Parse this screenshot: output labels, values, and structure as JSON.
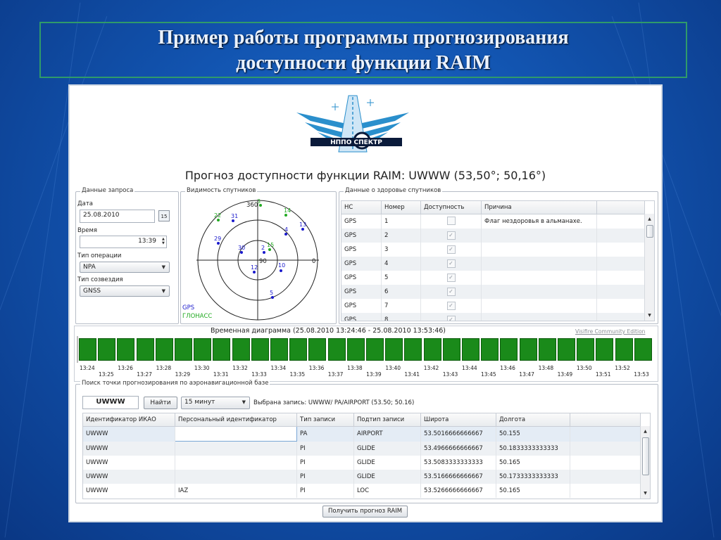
{
  "slide": {
    "title_line1": "Пример  работы программы прогнозирования",
    "title_line2": "доступности функции RAIM"
  },
  "logo": {
    "text": "НППО СПЕКТР"
  },
  "report_title": "Прогноз доступности функции RAIM: UWWW (53,50°; 50,16°)",
  "request": {
    "legend": "Данные запроса",
    "date_label": "Дата",
    "date_value": "25.08.2010",
    "calendar_num": "15",
    "time_label": "Время",
    "time_value": "13:39",
    "op_label": "Тип операции",
    "op_value": "NPA",
    "const_label": "Тип созвездия",
    "const_value": "GNSS"
  },
  "visibility": {
    "legend": "Видимость спутников",
    "labels": {
      "top": "360",
      "right": "0",
      "center": "90"
    },
    "legend_gps": "GPS",
    "legend_glonass": "ГЛОНАСС",
    "colors": {
      "gps": "#1a1acc",
      "glonass": "#22aa22"
    },
    "satellites": [
      {
        "id": "3",
        "sys": "glonass"
      },
      {
        "id": "14",
        "sys": "glonass"
      },
      {
        "id": "22",
        "sys": "glonass"
      },
      {
        "id": "31",
        "sys": "gps"
      },
      {
        "id": "13",
        "sys": "gps"
      },
      {
        "id": "4",
        "sys": "gps"
      },
      {
        "id": "29",
        "sys": "gps"
      },
      {
        "id": "30",
        "sys": "gps"
      },
      {
        "id": "2",
        "sys": "gps"
      },
      {
        "id": "15",
        "sys": "glonass"
      },
      {
        "id": "12",
        "sys": "gps"
      },
      {
        "id": "10",
        "sys": "gps"
      },
      {
        "id": "5",
        "sys": "gps"
      }
    ]
  },
  "health": {
    "legend": "Данные о здоровье спутников",
    "columns": [
      "НС",
      "Номер",
      "Доступность",
      "Причина"
    ],
    "rows": [
      {
        "ns": "GPS",
        "num": "1",
        "avail": "",
        "reason": "Флаг нездоровья в альманахе."
      },
      {
        "ns": "GPS",
        "num": "2",
        "avail": "✓",
        "reason": ""
      },
      {
        "ns": "GPS",
        "num": "3",
        "avail": "✓",
        "reason": ""
      },
      {
        "ns": "GPS",
        "num": "4",
        "avail": "✓",
        "reason": ""
      },
      {
        "ns": "GPS",
        "num": "5",
        "avail": "✓",
        "reason": ""
      },
      {
        "ns": "GPS",
        "num": "6",
        "avail": "✓",
        "reason": ""
      },
      {
        "ns": "GPS",
        "num": "7",
        "avail": "✓",
        "reason": ""
      },
      {
        "ns": "GPS",
        "num": "8",
        "avail": "✓",
        "reason": ""
      }
    ]
  },
  "timeline": {
    "title": "Временная диаграмма (25.08.2010 13:24:46 - 25.08.2010 13:53:46)",
    "watermark": "Visifire Community Edition",
    "ticks_top": [
      "13:24",
      "13:26",
      "13:28",
      "13:30",
      "13:32",
      "13:34",
      "13:36",
      "13:38",
      "13:40",
      "13:42",
      "13:44",
      "13:46",
      "13:48",
      "13:50",
      "13:52"
    ],
    "ticks_bottom": [
      "13:25",
      "13:27",
      "13:29",
      "13:31",
      "13:33",
      "13:35",
      "13:37",
      "13:39",
      "13:41",
      "13:43",
      "13:45",
      "13:47",
      "13:49",
      "13:51",
      "13:53"
    ],
    "bar_color": "#1a8a1a"
  },
  "search": {
    "legend": "Поиск точки прогнозирования по аэронавигационной базе",
    "query": "UWWW",
    "find_label": "Найти",
    "interval": "15 минут",
    "selected": "Выбрана запись: UWWW/ PA/AIRPORT (53.50; 50.16)",
    "columns": [
      "Идентификатор ИКАО",
      "Персональный идентификатор",
      "Тип записи",
      "Подтип записи",
      "Широта",
      "Долгота"
    ],
    "rows": [
      {
        "icao": "UWWW",
        "pid": "",
        "type": "PA",
        "sub": "AIRPORT",
        "lat": "53.5016666666667",
        "lon": "50.155"
      },
      {
        "icao": "UWWW",
        "pid": "",
        "type": "PI",
        "sub": "GLIDE",
        "lat": "53.4966666666667",
        "lon": "50.1833333333333"
      },
      {
        "icao": "UWWW",
        "pid": "",
        "type": "PI",
        "sub": "GLIDE",
        "lat": "53.5083333333333",
        "lon": "50.165"
      },
      {
        "icao": "UWWW",
        "pid": "",
        "type": "PI",
        "sub": "GLIDE",
        "lat": "53.5166666666667",
        "lon": "50.1733333333333"
      },
      {
        "icao": "UWWW",
        "pid": "IAZ",
        "type": "PI",
        "sub": "LOC",
        "lat": "53.5266666666667",
        "lon": "50.165"
      }
    ],
    "forecast_button": "Получить прогноз RAIM"
  }
}
